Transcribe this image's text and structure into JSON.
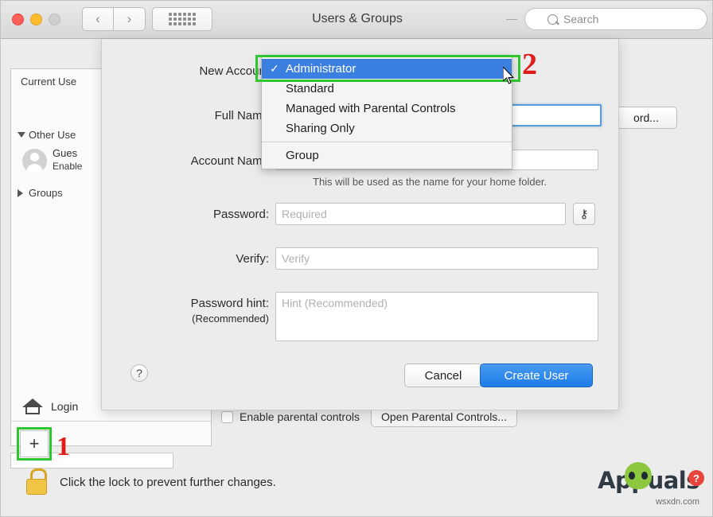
{
  "window": {
    "title": "Users & Groups",
    "search_placeholder": "Search",
    "nav_back": "‹",
    "nav_forward": "›"
  },
  "sidebar": {
    "current_user_header": "Current Use",
    "other_users_label": "Other Use",
    "guest_user": "Gues",
    "guest_sub": "Enable",
    "groups_label": "Groups",
    "login_label": "Login",
    "add_button": "+"
  },
  "parental": {
    "checkbox_label": "Enable parental controls",
    "open_button": "Open Parental Controls..."
  },
  "lock": {
    "text": "Click the lock to prevent further changes."
  },
  "background": {
    "password_button": "ord..."
  },
  "sheet": {
    "fields": [
      {
        "label": "New Account",
        "value": "",
        "placeholder": ""
      },
      {
        "label": "Full Name",
        "value": "",
        "placeholder": ""
      },
      {
        "label": "Account Name",
        "value": "",
        "placeholder": ""
      },
      {
        "label": "Password:",
        "value": "",
        "placeholder": "Required"
      },
      {
        "label": "Verify:",
        "value": "",
        "placeholder": "Verify"
      },
      {
        "label": "Password hint:",
        "value": "",
        "placeholder": "Hint (Recommended)"
      }
    ],
    "hint_sublabel": "(Recommended)",
    "account_note": "This will be used as the name for your home folder.",
    "help_button": "?",
    "key_button": "⚷",
    "cancel_button": "Cancel",
    "create_button": "Create User"
  },
  "popup": {
    "items": [
      {
        "label": "Administrator",
        "checked": true,
        "selected": true
      },
      {
        "label": "Standard",
        "checked": false,
        "selected": false
      },
      {
        "label": "Managed with Parental Controls",
        "checked": false,
        "selected": false
      },
      {
        "label": "Sharing Only",
        "checked": false,
        "selected": false
      },
      {
        "label": "Group",
        "checked": false,
        "selected": false,
        "after_separator": true
      }
    ],
    "check_glyph": "✓"
  },
  "annotations": {
    "step1": "1",
    "step2": "2",
    "highlight_color": "#2ec52e",
    "number_color": "#e01b1b"
  },
  "watermark": {
    "name": "Appuals",
    "domain": "wsxdn.com",
    "badge": "?"
  }
}
